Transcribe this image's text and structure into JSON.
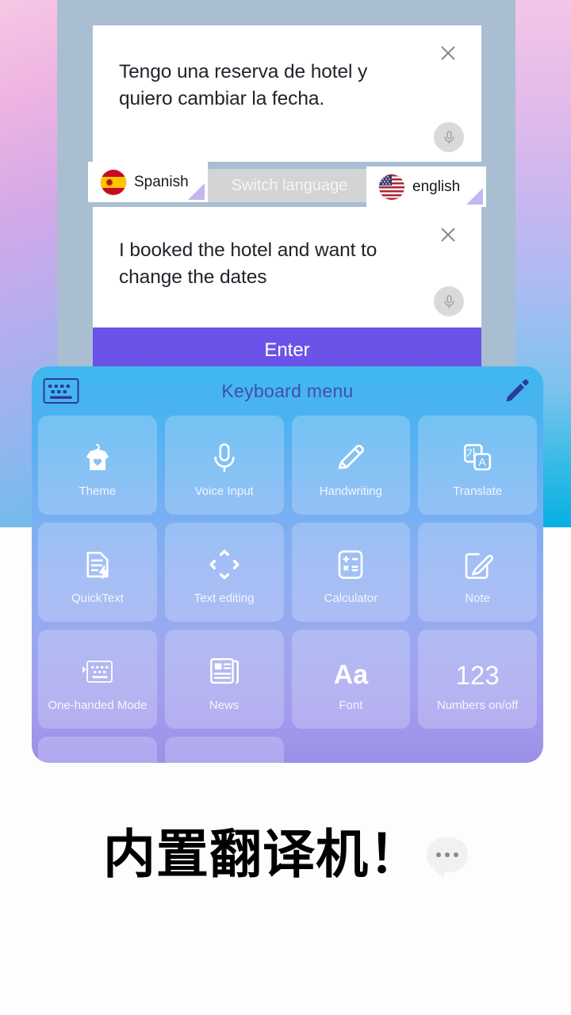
{
  "background": {
    "gradient_start": "#f7c7e4",
    "gradient_end": "#07b0e2",
    "app_panel_color": "#a9bed1"
  },
  "translator": {
    "source_box": {
      "text": "Tengo una reserva de hotel y quiero cambiar la fecha.",
      "close_icon": "close-icon",
      "mic_icon": "microphone-icon"
    },
    "target_box": {
      "text": "I booked the hotel and want to change the dates",
      "close_icon": "close-icon",
      "mic_icon": "microphone-icon"
    },
    "language_bar": {
      "source_language": "Spanish",
      "source_flag": "spain-flag-icon",
      "target_language": "english",
      "target_flag": "usa-flag-icon",
      "switch_label": "Switch language",
      "switch_bg": "#d3d4d6"
    },
    "enter_label": "Enter",
    "enter_color": "#6c52e8"
  },
  "keyboard_menu": {
    "title": "Keyboard menu",
    "left_icon": "keyboard-icon",
    "right_icon": "pencil-edit-icon",
    "title_color": "#3f4fb0",
    "tiles": [
      {
        "label": "Theme",
        "icon": "tshirt-heart-icon"
      },
      {
        "label": "Voice Input",
        "icon": "microphone-icon"
      },
      {
        "label": "Handwriting",
        "icon": "pencil-icon"
      },
      {
        "label": "Translate",
        "icon": "translate-cards-icon"
      },
      {
        "label": "QuickText",
        "icon": "document-bolt-icon"
      },
      {
        "label": "Text editing",
        "icon": "four-arrows-icon"
      },
      {
        "label": "Calculator",
        "icon": "calculator-icon"
      },
      {
        "label": "Note",
        "icon": "note-pencil-icon"
      },
      {
        "label": "One-handed Mode",
        "icon": "one-handed-keyboard-icon"
      },
      {
        "label": "News",
        "icon": "newspaper-icon"
      },
      {
        "label": "Font",
        "icon": "Aa"
      },
      {
        "label": "Numbers on/off",
        "icon": "123"
      }
    ],
    "partial_row_tiles": 2
  },
  "caption": {
    "text": "内置翻译机！",
    "bubble_icon": "speech-bubble-dots-icon"
  }
}
